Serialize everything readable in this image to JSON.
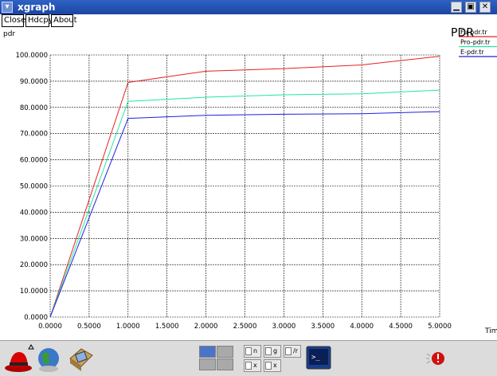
{
  "window": {
    "title": "xgraph",
    "menu_icon": "chevron-down-icon",
    "controls": [
      "minimize-icon",
      "maximize-icon",
      "close-icon"
    ]
  },
  "toolbar": {
    "close_label": "Close",
    "hdcpy_label": "Hdcpy",
    "about_label": "About"
  },
  "plot": {
    "title": "PDR",
    "ylabel": "pdr",
    "xlabel": "Time"
  },
  "chart_data": {
    "type": "line",
    "title": "PDR",
    "xlabel": "Time",
    "ylabel": "pdr",
    "xlim": [
      0,
      5
    ],
    "ylim": [
      0,
      100
    ],
    "grid": true,
    "legend": "top-right",
    "x_ticks": [
      "0.0000",
      "0.5000",
      "1.0000",
      "1.5000",
      "2.0000",
      "2.5000",
      "3.0000",
      "3.5000",
      "4.0000",
      "4.5000",
      "5.0000"
    ],
    "y_ticks": [
      "0.0000",
      "10.0000",
      "20.0000",
      "30.0000",
      "40.0000",
      "50.0000",
      "60.0000",
      "70.0000",
      "80.0000",
      "90.0000",
      "100.0000"
    ],
    "series": [
      {
        "name": "Fu-pdr.tr",
        "color": "#e82020",
        "points": [
          [
            0,
            0
          ],
          [
            1,
            89.5
          ],
          [
            2,
            93.8
          ],
          [
            3,
            94.8
          ],
          [
            4,
            96.2
          ],
          [
            5,
            99.5
          ]
        ]
      },
      {
        "name": "Pro-pdr.tr",
        "color": "#20e8a0",
        "points": [
          [
            0,
            0
          ],
          [
            1,
            82.3
          ],
          [
            2,
            83.9
          ],
          [
            3,
            84.8
          ],
          [
            4,
            85.2
          ],
          [
            5,
            86.6
          ]
        ]
      },
      {
        "name": "E-pdr.tr",
        "color": "#2020e0",
        "points": [
          [
            0,
            0
          ],
          [
            1,
            75.8
          ],
          [
            2,
            77.0
          ],
          [
            3,
            77.4
          ],
          [
            4,
            77.6
          ],
          [
            5,
            78.4
          ]
        ]
      }
    ]
  },
  "taskbar": {
    "launchers": [
      "redhat-menu-icon",
      "browser-globe-icon",
      "mail-icon",
      "print-manager-icon"
    ],
    "tasks": [
      {
        "label": "n",
        "icon": "window-icon"
      },
      {
        "label": "g",
        "icon": "window-icon"
      },
      {
        "label": "/r",
        "icon": "window-icon"
      },
      {
        "label": "x",
        "icon": "window-icon"
      },
      {
        "label": "x",
        "icon": "window-icon"
      }
    ],
    "terminal_icon": "terminal-icon",
    "alert_icon": "alert-icon"
  }
}
